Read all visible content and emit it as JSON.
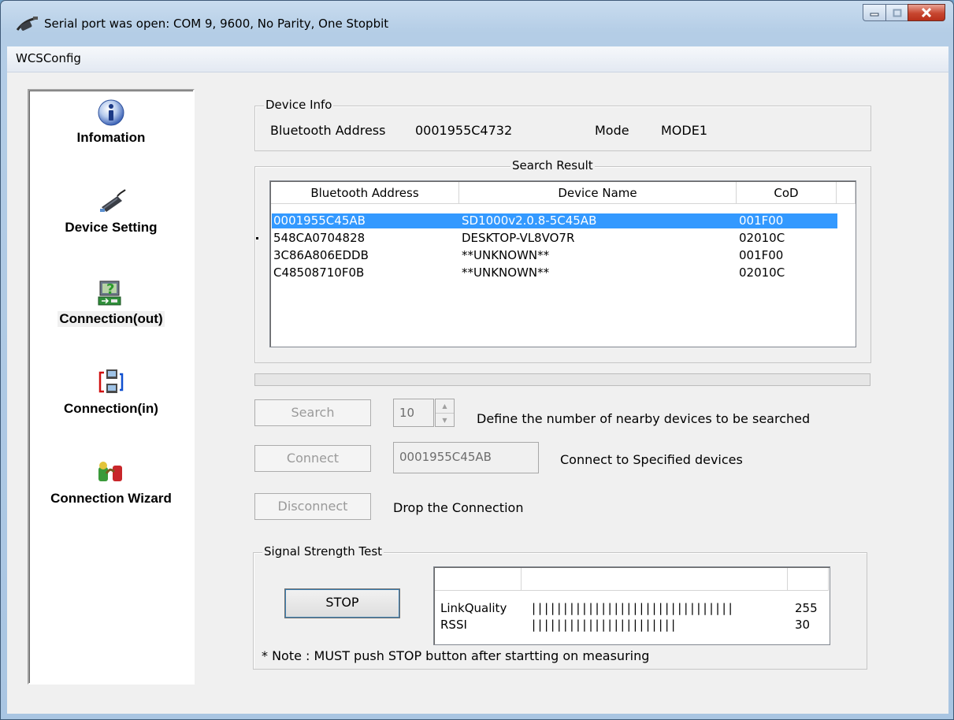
{
  "window": {
    "title": "Serial port was open: COM 9, 9600, No Parity, One Stopbit",
    "icon": "serial-cable-icon"
  },
  "menu": {
    "items": [
      {
        "label": "WCSConfig"
      }
    ]
  },
  "sidebar": {
    "items": [
      {
        "label": "Infomation",
        "icon": "info-icon",
        "selected": false
      },
      {
        "label": "Device Setting",
        "icon": "device-icon",
        "selected": false
      },
      {
        "label": "Connection(out)",
        "icon": "connection-out-icon",
        "selected": true
      },
      {
        "label": "Connection(in)",
        "icon": "connection-in-icon",
        "selected": false
      },
      {
        "label": "Connection Wizard",
        "icon": "wizard-icon",
        "selected": false
      }
    ]
  },
  "device_info": {
    "title": "Device Info",
    "address_label": "Bluetooth Address",
    "address_value": "0001955C4732",
    "mode_label": "Mode",
    "mode_value": "MODE1"
  },
  "search_result": {
    "title": "Search Result",
    "columns": [
      "Bluetooth Address",
      "Device Name",
      "CoD"
    ],
    "rows": [
      {
        "address": "0001955C45AB",
        "name": "SD1000v2.0.8-5C45AB",
        "cod": "001F00",
        "selected": true
      },
      {
        "address": "548CA0704828",
        "name": "DESKTOP-VL8VO7R",
        "cod": "02010C",
        "selected": false
      },
      {
        "address": "3C86A806EDDB",
        "name": "**UNKNOWN**",
        "cod": "001F00",
        "selected": false
      },
      {
        "address": "C48508710F0B",
        "name": "**UNKNOWN**",
        "cod": "02010C",
        "selected": false
      }
    ]
  },
  "controls": {
    "search_label": "Search",
    "search_count": "10",
    "search_desc": "Define the number of nearby devices to be searched",
    "connect_label": "Connect",
    "connect_address": "0001955C45AB",
    "connect_desc": "Connect to Specified devices",
    "disconnect_label": "Disconnect",
    "disconnect_desc": "Drop the Connection"
  },
  "signal": {
    "title": "Signal Strength Test",
    "stop_label": "STOP",
    "rows": [
      {
        "name": "LinkQuality",
        "bar": "||||||||||||||||||||||||||||||||",
        "value": "255"
      },
      {
        "name": "RSSI",
        "bar": "|||||||||||||||||||||||",
        "value": "30"
      }
    ],
    "note": "* Note : MUST push STOP button after startting on measuring"
  },
  "colors": {
    "selection": "#3399ff",
    "window_frame": "#b4cde6",
    "client": "#f0f0f0"
  }
}
